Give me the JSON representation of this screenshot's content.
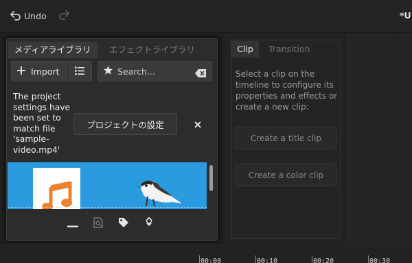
{
  "app": {
    "project_title": "*U"
  },
  "toolbar": {
    "undo_label": "Undo",
    "redo_enabled": false
  },
  "media_library": {
    "tabs": [
      {
        "label": "メディアライブラリ",
        "active": true
      },
      {
        "label": "エフェクトライブラリ",
        "active": false
      }
    ],
    "import_label": "Import",
    "search_placeholder": "Search...",
    "notice": "The project settings have been set to match file 'sample-video.mp4'",
    "project_settings_button": "プロジェクトの設定",
    "items": [
      {
        "kind": "audio",
        "icon": "music-note-icon"
      },
      {
        "kind": "video",
        "icon": "bird-thumbnail"
      }
    ],
    "bottom_tools": [
      "remove-icon",
      "preview-file-icon",
      "tag-icon",
      "sort-icon"
    ]
  },
  "clip_panel": {
    "tabs": [
      {
        "label": "Clip",
        "active": true
      },
      {
        "label": "Transition",
        "active": false
      }
    ],
    "hint": "Select a clip on the timeline to configure its properties and effects or create a new clip:",
    "create_title_label": "Create a title clip",
    "create_color_label": "Create a color clip"
  },
  "timeline": {
    "ticks": [
      "00:00",
      "00:10",
      "00:20",
      "00:30"
    ]
  },
  "colors": {
    "background": "#222222",
    "thumbnail_strip": "#2a9bde",
    "audio_icon": "#f0812b"
  }
}
